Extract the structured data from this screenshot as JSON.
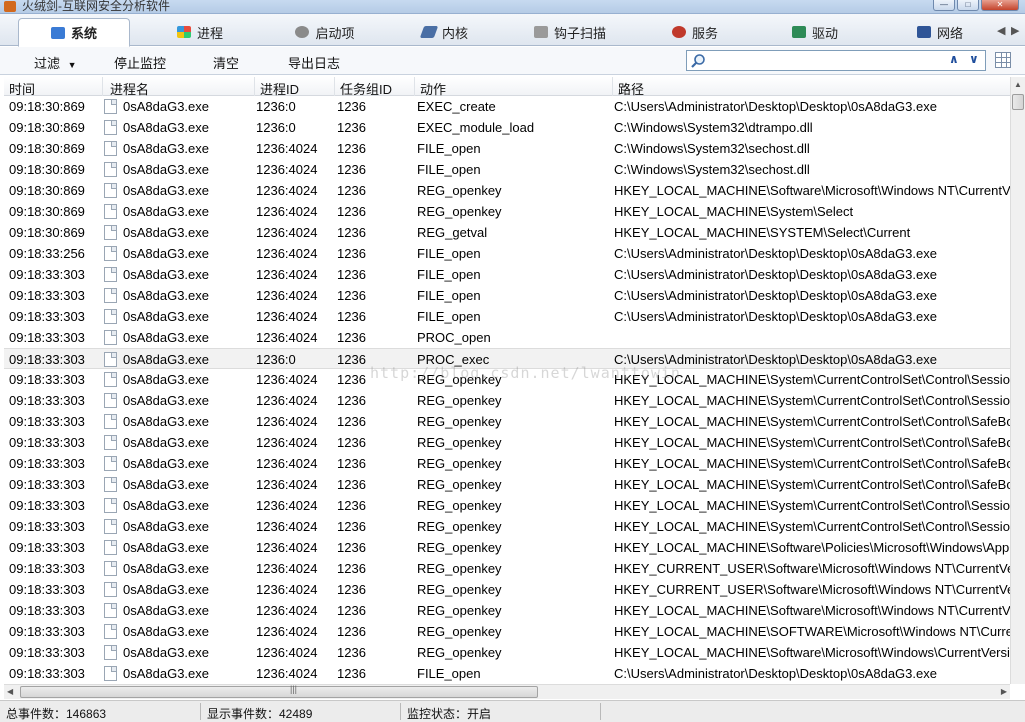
{
  "window": {
    "title": "火绒剑-互联网安全分析软件"
  },
  "tabs": [
    {
      "label": "系统",
      "icon": "system-monitor-icon",
      "color": "#3a7bd5"
    },
    {
      "label": "进程",
      "icon": "process-windows-icon",
      "color": "#e8a317"
    },
    {
      "label": "启动项",
      "icon": "startup-gear-icon",
      "color": "#6d6d6d"
    },
    {
      "label": "内核",
      "icon": "kernel-tool-icon",
      "color": "#4a6fa5"
    },
    {
      "label": "钩子扫描",
      "icon": "hook-scan-icon",
      "color": "#7b7b7b"
    },
    {
      "label": "服务",
      "icon": "service-icon",
      "color": "#c0392b"
    },
    {
      "label": "驱动",
      "icon": "driver-icon",
      "color": "#2e8b57"
    },
    {
      "label": "网络",
      "icon": "network-icon",
      "color": "#2f5597"
    }
  ],
  "toolbar": {
    "filter_label": "过滤",
    "stop_label": "停止监控",
    "clear_label": "清空",
    "export_label": "导出日志",
    "search_value": ""
  },
  "columns": {
    "time": "时间",
    "process": "进程名",
    "pid": "进程ID",
    "task_group": "任务组ID",
    "action": "动作",
    "path": "路径"
  },
  "rows": [
    {
      "time": "09:18:30:869",
      "process": "0sA8daG3.exe",
      "pid": "1236:0",
      "task_group": "1236",
      "action": "EXEC_create",
      "path": "C:\\Users\\Administrator\\Desktop\\Desktop\\0sA8daG3.exe"
    },
    {
      "time": "09:18:30:869",
      "process": "0sA8daG3.exe",
      "pid": "1236:0",
      "task_group": "1236",
      "action": "EXEC_module_load",
      "path": "C:\\Windows\\System32\\dtrampo.dll"
    },
    {
      "time": "09:18:30:869",
      "process": "0sA8daG3.exe",
      "pid": "1236:4024",
      "task_group": "1236",
      "action": "FILE_open",
      "path": "C:\\Windows\\System32\\sechost.dll"
    },
    {
      "time": "09:18:30:869",
      "process": "0sA8daG3.exe",
      "pid": "1236:4024",
      "task_group": "1236",
      "action": "FILE_open",
      "path": "C:\\Windows\\System32\\sechost.dll"
    },
    {
      "time": "09:18:30:869",
      "process": "0sA8daG3.exe",
      "pid": "1236:4024",
      "task_group": "1236",
      "action": "REG_openkey",
      "path": "HKEY_LOCAL_MACHINE\\Software\\Microsoft\\Windows NT\\CurrentVe"
    },
    {
      "time": "09:18:30:869",
      "process": "0sA8daG3.exe",
      "pid": "1236:4024",
      "task_group": "1236",
      "action": "REG_openkey",
      "path": "HKEY_LOCAL_MACHINE\\System\\Select"
    },
    {
      "time": "09:18:30:869",
      "process": "0sA8daG3.exe",
      "pid": "1236:4024",
      "task_group": "1236",
      "action": "REG_getval",
      "path": "HKEY_LOCAL_MACHINE\\SYSTEM\\Select\\Current"
    },
    {
      "time": "09:18:33:256",
      "process": "0sA8daG3.exe",
      "pid": "1236:4024",
      "task_group": "1236",
      "action": "FILE_open",
      "path": "C:\\Users\\Administrator\\Desktop\\Desktop\\0sA8daG3.exe"
    },
    {
      "time": "09:18:33:303",
      "process": "0sA8daG3.exe",
      "pid": "1236:4024",
      "task_group": "1236",
      "action": "FILE_open",
      "path": "C:\\Users\\Administrator\\Desktop\\Desktop\\0sA8daG3.exe"
    },
    {
      "time": "09:18:33:303",
      "process": "0sA8daG3.exe",
      "pid": "1236:4024",
      "task_group": "1236",
      "action": "FILE_open",
      "path": "C:\\Users\\Administrator\\Desktop\\Desktop\\0sA8daG3.exe"
    },
    {
      "time": "09:18:33:303",
      "process": "0sA8daG3.exe",
      "pid": "1236:4024",
      "task_group": "1236",
      "action": "FILE_open",
      "path": "C:\\Users\\Administrator\\Desktop\\Desktop\\0sA8daG3.exe"
    },
    {
      "time": "09:18:33:303",
      "process": "0sA8daG3.exe",
      "pid": "1236:4024",
      "task_group": "1236",
      "action": "PROC_open",
      "path": ""
    },
    {
      "time": "09:18:33:303",
      "process": "0sA8daG3.exe",
      "pid": "1236:0",
      "task_group": "1236",
      "action": "PROC_exec",
      "path": "C:\\Users\\Administrator\\Desktop\\Desktop\\0sA8daG3.exe",
      "selected": true
    },
    {
      "time": "09:18:33:303",
      "process": "0sA8daG3.exe",
      "pid": "1236:4024",
      "task_group": "1236",
      "action": "REG_openkey",
      "path": "HKEY_LOCAL_MACHINE\\System\\CurrentControlSet\\Control\\Session M"
    },
    {
      "time": "09:18:33:303",
      "process": "0sA8daG3.exe",
      "pid": "1236:4024",
      "task_group": "1236",
      "action": "REG_openkey",
      "path": "HKEY_LOCAL_MACHINE\\System\\CurrentControlSet\\Control\\Session M"
    },
    {
      "time": "09:18:33:303",
      "process": "0sA8daG3.exe",
      "pid": "1236:4024",
      "task_group": "1236",
      "action": "REG_openkey",
      "path": "HKEY_LOCAL_MACHINE\\System\\CurrentControlSet\\Control\\SafeBoot"
    },
    {
      "time": "09:18:33:303",
      "process": "0sA8daG3.exe",
      "pid": "1236:4024",
      "task_group": "1236",
      "action": "REG_openkey",
      "path": "HKEY_LOCAL_MACHINE\\System\\CurrentControlSet\\Control\\SafeBoot"
    },
    {
      "time": "09:18:33:303",
      "process": "0sA8daG3.exe",
      "pid": "1236:4024",
      "task_group": "1236",
      "action": "REG_openkey",
      "path": "HKEY_LOCAL_MACHINE\\System\\CurrentControlSet\\Control\\SafeBoot"
    },
    {
      "time": "09:18:33:303",
      "process": "0sA8daG3.exe",
      "pid": "1236:4024",
      "task_group": "1236",
      "action": "REG_openkey",
      "path": "HKEY_LOCAL_MACHINE\\System\\CurrentControlSet\\Control\\SafeBoot"
    },
    {
      "time": "09:18:33:303",
      "process": "0sA8daG3.exe",
      "pid": "1236:4024",
      "task_group": "1236",
      "action": "REG_openkey",
      "path": "HKEY_LOCAL_MACHINE\\System\\CurrentControlSet\\Control\\Session M"
    },
    {
      "time": "09:18:33:303",
      "process": "0sA8daG3.exe",
      "pid": "1236:4024",
      "task_group": "1236",
      "action": "REG_openkey",
      "path": "HKEY_LOCAL_MACHINE\\System\\CurrentControlSet\\Control\\Session M"
    },
    {
      "time": "09:18:33:303",
      "process": "0sA8daG3.exe",
      "pid": "1236:4024",
      "task_group": "1236",
      "action": "REG_openkey",
      "path": "HKEY_LOCAL_MACHINE\\Software\\Policies\\Microsoft\\Windows\\AppCo"
    },
    {
      "time": "09:18:33:303",
      "process": "0sA8daG3.exe",
      "pid": "1236:4024",
      "task_group": "1236",
      "action": "REG_openkey",
      "path": "HKEY_CURRENT_USER\\Software\\Microsoft\\Windows NT\\CurrentVers"
    },
    {
      "time": "09:18:33:303",
      "process": "0sA8daG3.exe",
      "pid": "1236:4024",
      "task_group": "1236",
      "action": "REG_openkey",
      "path": "HKEY_CURRENT_USER\\Software\\Microsoft\\Windows NT\\CurrentVers"
    },
    {
      "time": "09:18:33:303",
      "process": "0sA8daG3.exe",
      "pid": "1236:4024",
      "task_group": "1236",
      "action": "REG_openkey",
      "path": "HKEY_LOCAL_MACHINE\\Software\\Microsoft\\Windows NT\\CurrentVe"
    },
    {
      "time": "09:18:33:303",
      "process": "0sA8daG3.exe",
      "pid": "1236:4024",
      "task_group": "1236",
      "action": "REG_openkey",
      "path": "HKEY_LOCAL_MACHINE\\SOFTWARE\\Microsoft\\Windows NT\\Current"
    },
    {
      "time": "09:18:33:303",
      "process": "0sA8daG3.exe",
      "pid": "1236:4024",
      "task_group": "1236",
      "action": "REG_openkey",
      "path": "HKEY_LOCAL_MACHINE\\Software\\Microsoft\\Windows\\CurrentVersio"
    },
    {
      "time": "09:18:33:303",
      "process": "0sA8daG3.exe",
      "pid": "1236:4024",
      "task_group": "1236",
      "action": "FILE_open",
      "path": "C:\\Users\\Administrator\\Desktop\\Desktop\\0sA8daG3.exe"
    }
  ],
  "watermark": "http://blog.csdn.net/lwanttowin",
  "scroll_glyphs": {
    "up": "▲",
    "left": "◀",
    "right": "▶",
    "grip": "|||"
  },
  "status": {
    "total_events": "总事件数：146863",
    "shown_events": "显示事件数：42489",
    "monitor_state": "监控状态：开启"
  }
}
